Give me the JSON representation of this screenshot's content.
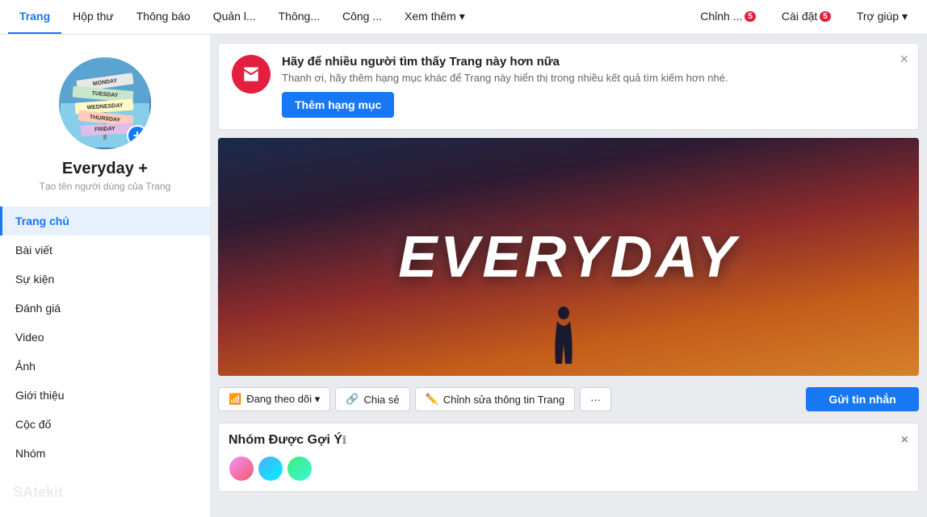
{
  "nav": {
    "items": [
      {
        "id": "trang",
        "label": "Trang",
        "active": true
      },
      {
        "id": "hop-thu",
        "label": "Hộp thư",
        "active": false
      },
      {
        "id": "thong-bao",
        "label": "Thông báo",
        "active": false
      },
      {
        "id": "quan-ly",
        "label": "Quản l...",
        "active": false
      },
      {
        "id": "thong-ke",
        "label": "Thông...",
        "active": false
      },
      {
        "id": "cong-cu",
        "label": "Công ...",
        "active": false
      },
      {
        "id": "xem-them",
        "label": "Xem thêm ▾",
        "active": false
      }
    ],
    "right_items": [
      {
        "id": "chinh-sua",
        "label": "Chỉnh ...",
        "badge": "5"
      },
      {
        "id": "cai-dat",
        "label": "Cài đặt",
        "badge": "5"
      },
      {
        "id": "tro-giup",
        "label": "Trợ giúp ▾",
        "badge": ""
      }
    ]
  },
  "sidebar": {
    "page_name": "Everyday +",
    "page_subtext": "Tạo tên người dùng của Trang",
    "nav_items": [
      {
        "id": "trang-chu",
        "label": "Trang chủ",
        "active": true
      },
      {
        "id": "bai-viet",
        "label": "Bài viết",
        "active": false
      },
      {
        "id": "su-kien",
        "label": "Sự kiện",
        "active": false
      },
      {
        "id": "danh-gia",
        "label": "Đánh giá",
        "active": false
      },
      {
        "id": "video",
        "label": "Video",
        "active": false
      },
      {
        "id": "anh",
        "label": "Ảnh",
        "active": false
      },
      {
        "id": "gioi-thieu",
        "label": "Giới thiệu",
        "active": false
      },
      {
        "id": "cuoc-do",
        "label": "Cộc đố",
        "active": false
      },
      {
        "id": "nhom",
        "label": "Nhóm",
        "active": false
      }
    ],
    "watermark": "SAtekit"
  },
  "notification": {
    "title": "Hãy để nhiều người tìm thấy Trang này hơn nữa",
    "subtitle": "Thanh ơi, hãy thêm hạng mục khác để Trang này hiển thị trong nhiều kết quả tìm kiếm hơn nhé.",
    "button_label": "Thêm hạng mục"
  },
  "cover": {
    "text": "EVERYDAY"
  },
  "actions": {
    "follow_label": "Đang theo dõi ▾",
    "share_label": "Chia sẻ",
    "edit_label": "Chỉnh sửa thông tin Trang",
    "more_label": "···",
    "message_label": "Gửi tin nhắn"
  },
  "suggested_group": {
    "title": "Nhóm Được Gợi Ý",
    "info_label": "ℹ"
  }
}
